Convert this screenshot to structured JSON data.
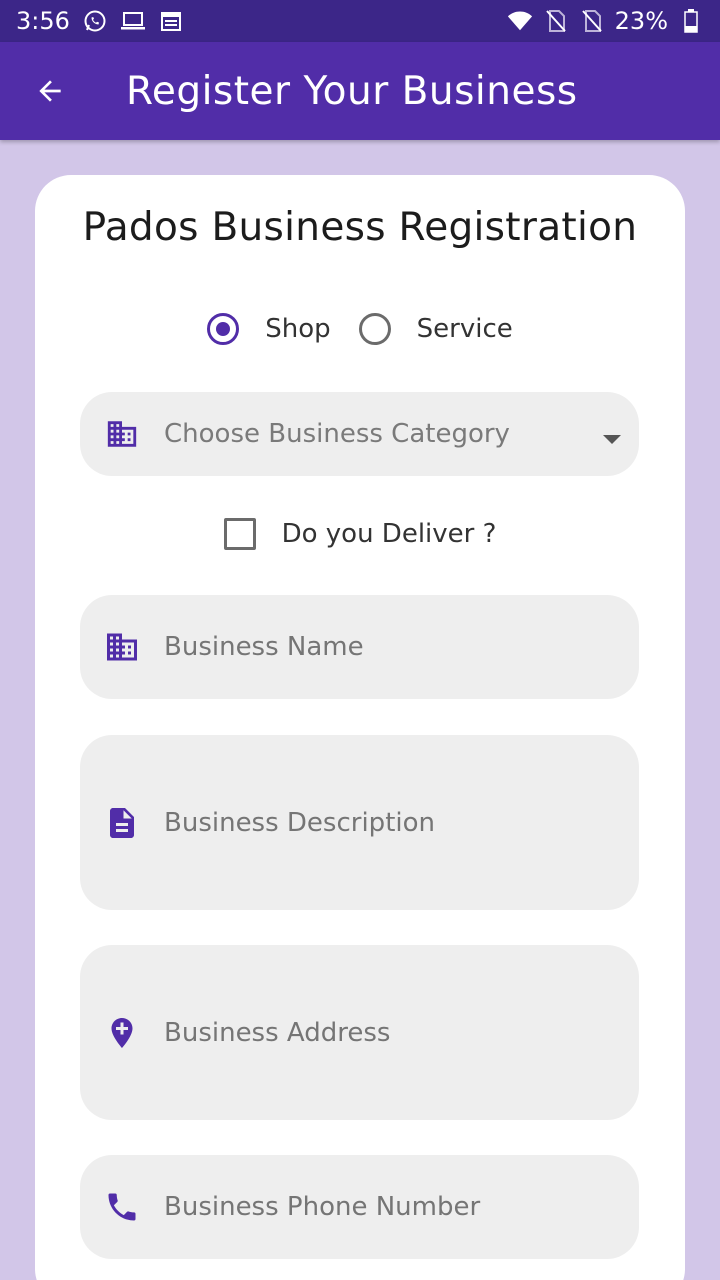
{
  "status_bar": {
    "time": "3:56",
    "battery": "23%",
    "icons": [
      "whatsapp-icon",
      "laptop-icon",
      "calendar-icon",
      "wifi-icon",
      "no-sim-icon",
      "no-sim-icon",
      "battery-icon"
    ]
  },
  "app_bar": {
    "title": "Register Your Business",
    "back_icon": "arrow-back-icon"
  },
  "form": {
    "title": "Pados Business Registration",
    "type_options": [
      {
        "label": "Shop",
        "checked": true
      },
      {
        "label": "Service",
        "checked": false
      }
    ],
    "category": {
      "placeholder": "Choose Business Category",
      "icon": "business-icon"
    },
    "deliver": {
      "label": "Do you Deliver ?",
      "checked": false
    },
    "fields": {
      "name": {
        "placeholder": "Business Name",
        "icon": "business-icon"
      },
      "description": {
        "placeholder": "Business Description",
        "icon": "description-icon"
      },
      "address": {
        "placeholder": "Business Address",
        "icon": "add-location-icon"
      },
      "phone": {
        "placeholder": "Business Phone Number",
        "icon": "phone-icon"
      }
    }
  },
  "colors": {
    "primary": "#512da8",
    "status_bar": "#3c2688",
    "background": "#d2c6e8",
    "field_bg": "#eeeeee"
  }
}
